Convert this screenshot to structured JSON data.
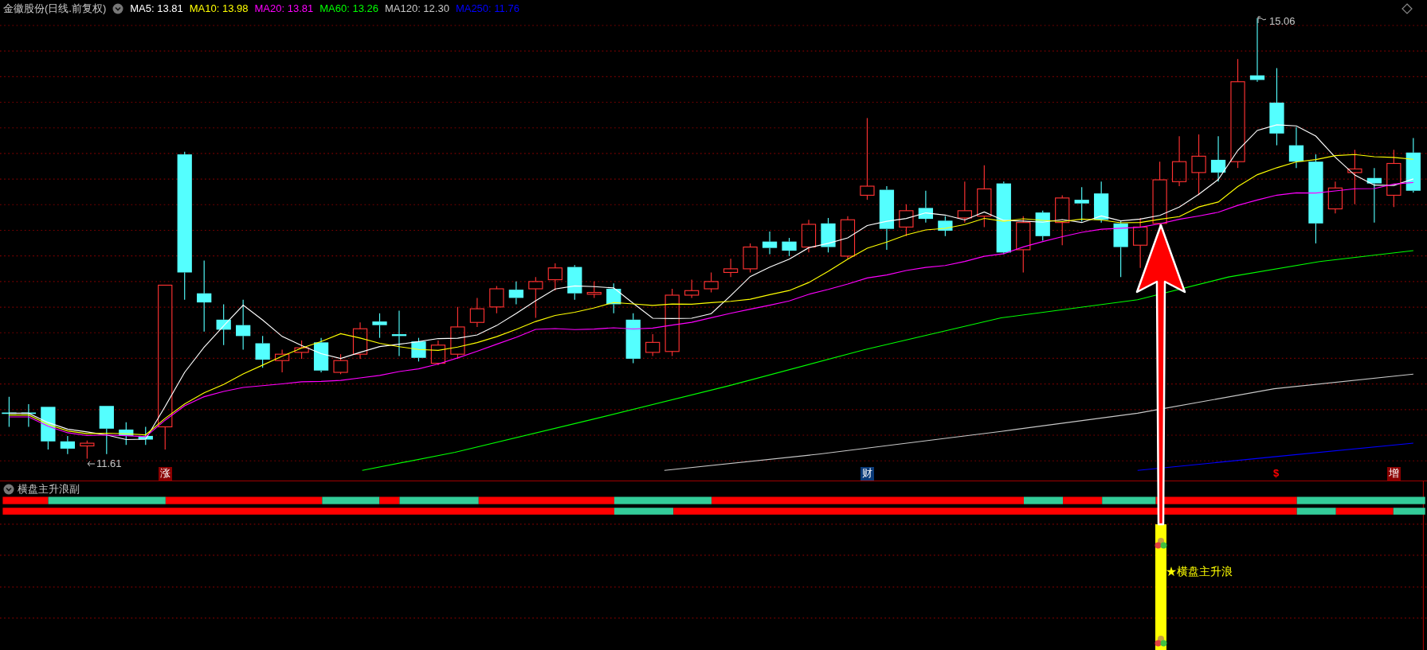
{
  "chart_header": {
    "title": "金徽股份(日线.前复权)",
    "legend": [
      {
        "label": "MA5: 13.81",
        "color": "#ffffff"
      },
      {
        "label": "MA10: 13.98",
        "color": "#ffff00"
      },
      {
        "label": "MA20: 13.81",
        "color": "#ff00ff"
      },
      {
        "label": "MA60: 13.26",
        "color": "#00ff00"
      },
      {
        "label": "MA120: 12.30",
        "color": "#c8c8c8"
      },
      {
        "label": "MA250: 11.76",
        "color": "#0000ff"
      }
    ]
  },
  "price_labels": [
    {
      "kind": "high",
      "text": "15.06"
    },
    {
      "kind": "low",
      "text": "11.61"
    }
  ],
  "event_markers": [
    {
      "kind": "boxed",
      "text": "涨",
      "color": "#8b0000"
    },
    {
      "kind": "boxed",
      "text": "财",
      "color": "#0a3a78"
    },
    {
      "kind": "plain",
      "text": "$",
      "color": "#ff0000"
    },
    {
      "kind": "boxed",
      "text": "增",
      "color": "#8b0000"
    }
  ],
  "indicator": {
    "title": "横盘主升浪副",
    "signal_label": "★横盘主升浪"
  }
}
